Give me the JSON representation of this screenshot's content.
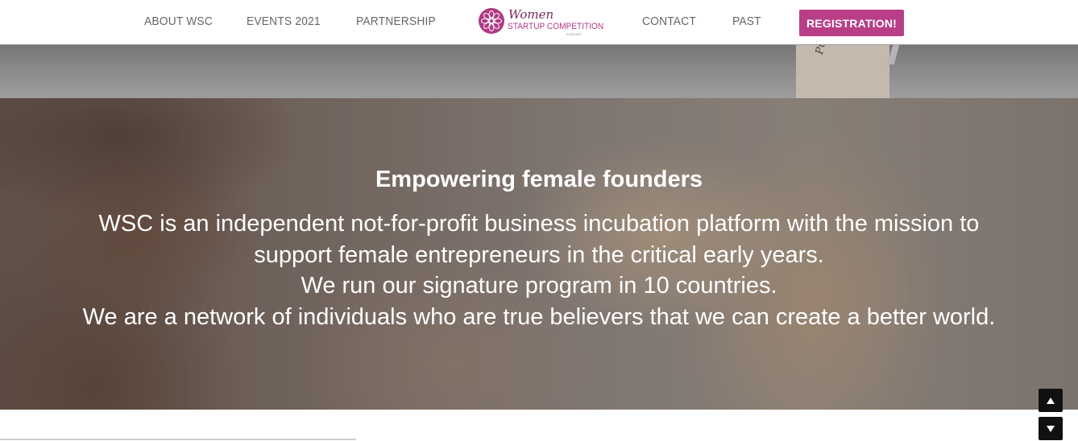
{
  "nav": {
    "left_links": [
      "ABOUT WSC",
      "EVENTS 2021",
      "PARTNERSHIP"
    ],
    "right_links": [
      "CONTACT",
      "PAST"
    ],
    "registration_label": "REGISTRATION!"
  },
  "logo": {
    "line1": "Women",
    "line2": "STARTUP COMPETITION",
    "line3": "EUROPE"
  },
  "hero": {
    "title": "Empowering female founders",
    "lines": [
      "WSC is an independent not-for-profit business incubation platform with the mission to",
      "support female entrepreneurs in the critical early years.",
      "We run our signature program in 10 countries.",
      "We are a network of individuals who are true believers that we can create a better world."
    ]
  },
  "photo_tag_text": "Pumpkin Chutney",
  "icons": {
    "logo_mark": "mandala-icon",
    "scroll_up": "arrow-up-icon",
    "scroll_down": "arrow-down-icon"
  },
  "colors": {
    "accent": "#b83f87",
    "nav_text": "#666666",
    "hero_text": "#ffffff",
    "scroll_button": "#111111"
  }
}
